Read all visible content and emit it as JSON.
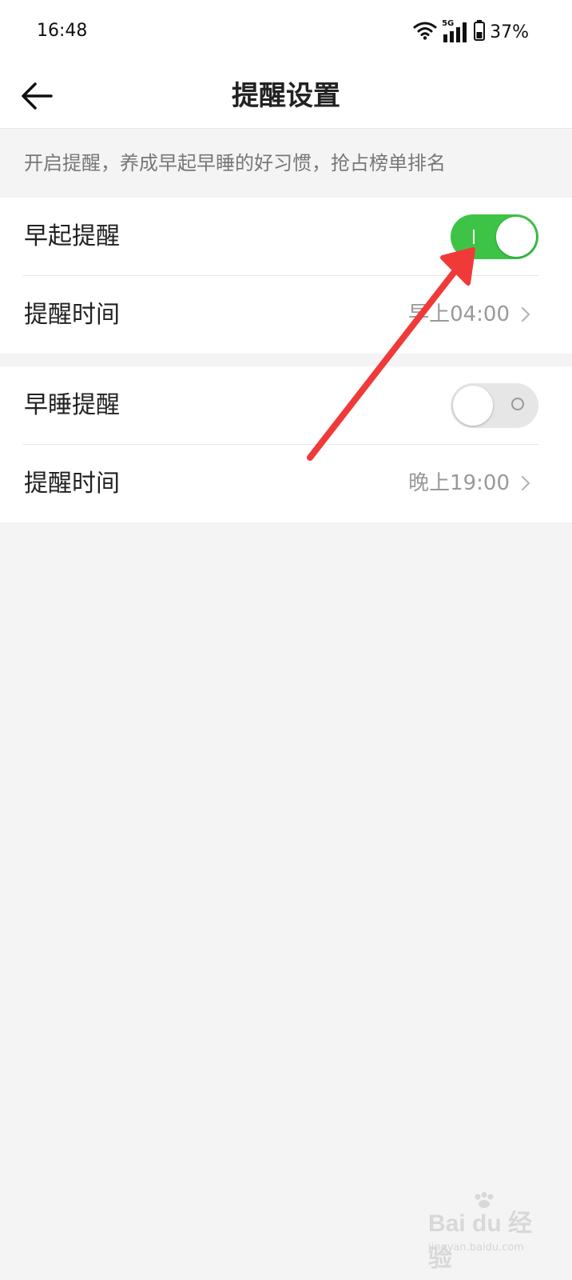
{
  "status_bar": {
    "time": "16:48",
    "network": "5G",
    "battery": "37%",
    "icons": [
      "wifi-icon",
      "signal-icon",
      "battery-icon"
    ]
  },
  "nav": {
    "back_icon": "arrow-left-icon",
    "title": "提醒设置"
  },
  "hint": "开启提醒，养成早起早睡的好习惯，抢占榜单排名",
  "groups": [
    {
      "toggle_label": "早起提醒",
      "toggle_on": true,
      "time_label": "提醒时间",
      "time_value": "早上04:00"
    },
    {
      "toggle_label": "早睡提醒",
      "toggle_on": false,
      "time_label": "提醒时间",
      "time_value": "晚上19:00"
    }
  ],
  "watermark": {
    "logo": "Bai du 经验",
    "sub": "jingyan.baidu.com"
  },
  "colors": {
    "toggle_on": "#3dc446",
    "toggle_off": "#e6e6e6",
    "annotation_arrow": "#f03a3a",
    "background": "#f4f4f4"
  }
}
